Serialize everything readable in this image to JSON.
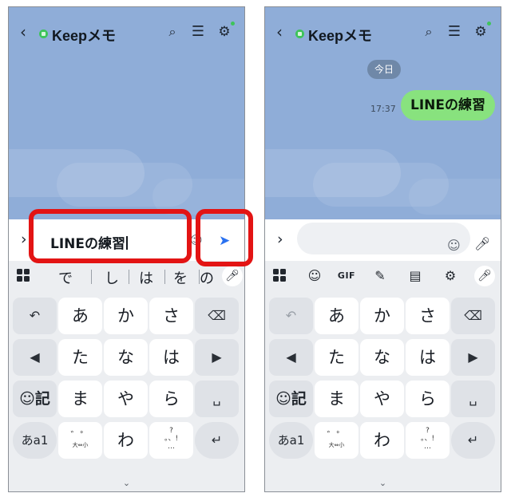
{
  "left_phone": {
    "header": {
      "title": "Keepメモ"
    },
    "input_text": "LINEの練習",
    "suggestions": [
      "で",
      "し",
      "は",
      "を",
      "の"
    ],
    "keys": {
      "row1": [
        "あ",
        "か",
        "さ"
      ],
      "row2": [
        "た",
        "な",
        "は"
      ],
      "row3": [
        "ま",
        "や",
        "ら"
      ],
      "row4_mid": "わ",
      "emoji_key": "☺記",
      "mode_key": "あa1",
      "dakuten_top": "゛゜",
      "dakuten_bottom": "大⇔小",
      "punct_top": "?",
      "punct_bottom": "。、!",
      "punct_dots": "…"
    },
    "send_icon": "paper-plane-icon",
    "annotations": {
      "input_highlight_color": "#e31414",
      "send_highlight_color": "#e31414"
    }
  },
  "right_phone": {
    "header": {
      "title": "Keepメモ"
    },
    "date_label": "今日",
    "message": {
      "time": "17:37",
      "text": "LINEの練習"
    },
    "toolbar": {
      "gif_label": "GIF"
    },
    "keys": {
      "row1": [
        "あ",
        "か",
        "さ"
      ],
      "row2": [
        "た",
        "な",
        "は"
      ],
      "row3": [
        "ま",
        "や",
        "ら"
      ],
      "row4_mid": "わ",
      "emoji_key": "☺記",
      "mode_key": "あa1",
      "dakuten_top": "゛゜",
      "dakuten_bottom": "大⇔小",
      "punct_top": "?",
      "punct_bottom": "。、!",
      "punct_dots": "…"
    }
  },
  "colors": {
    "chat_background": "#8fadd8",
    "bubble_green": "#88e27e",
    "keep_badge": "#3ec45a",
    "send_blue": "#2a71f0",
    "keyboard_bg": "#eceef1"
  }
}
